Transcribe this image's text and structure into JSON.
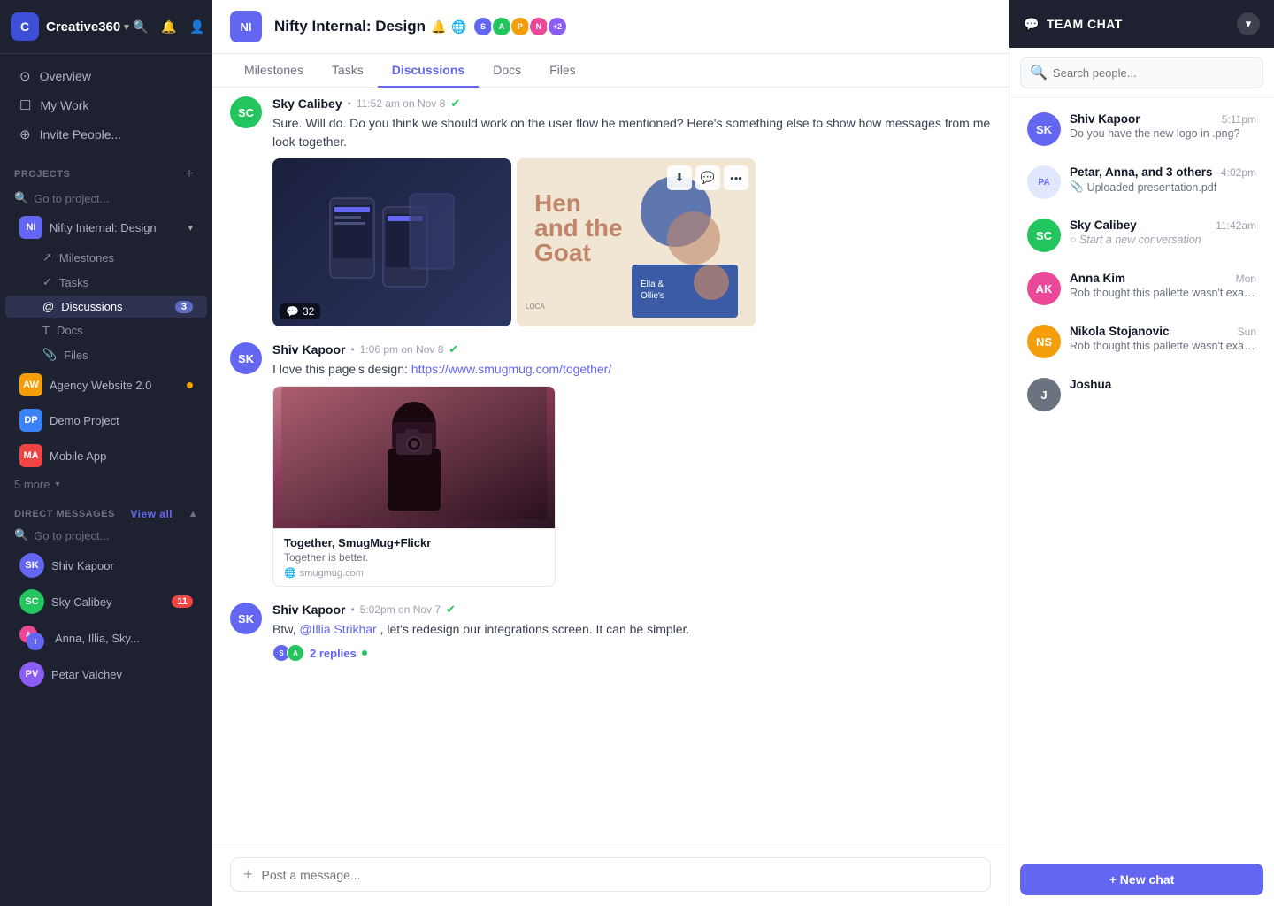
{
  "app": {
    "name": "Creative360",
    "logo_letter": "C"
  },
  "sidebar": {
    "nav": [
      {
        "label": "Overview",
        "icon": "⊙",
        "id": "overview"
      },
      {
        "label": "My Work",
        "icon": "☐",
        "id": "my-work"
      },
      {
        "label": "Invite People...",
        "icon": "⊕",
        "id": "invite"
      }
    ],
    "projects_label": "PROJECTS",
    "projects_add": "+",
    "projects_search_placeholder": "Go to project...",
    "projects": [
      {
        "label": "Nifty Internal: Design",
        "badge": "NI",
        "color": "#6366f1",
        "expanded": true
      },
      {
        "label": "Agency Website 2.0",
        "badge": "AW",
        "color": "#f59e0b",
        "has_dot": true
      },
      {
        "label": "Demo Project",
        "badge": "DP",
        "color": "#3b82f6"
      },
      {
        "label": "Mobile App",
        "badge": "MA",
        "color": "#ef4444"
      }
    ],
    "more_label": "5 more",
    "sub_nav": [
      {
        "label": "Milestones",
        "icon": "↗"
      },
      {
        "label": "Tasks",
        "icon": "✓"
      },
      {
        "label": "Discussions",
        "icon": "@",
        "active": true,
        "badge": 3
      },
      {
        "label": "Docs",
        "icon": "T"
      },
      {
        "label": "Files",
        "icon": "⌂"
      }
    ],
    "dm_label": "DIRECT MESSAGES",
    "dm_view_all": "View all",
    "dm_search_placeholder": "Go to project...",
    "dm_items": [
      {
        "name": "Shiv Kapoor",
        "avatar_color": "#6366f1",
        "initials": "SK"
      },
      {
        "name": "Sky Calibey",
        "avatar_color": "#22c55e",
        "initials": "SC",
        "badge": 11
      },
      {
        "name": "Anna, Illia, Sky...",
        "avatar_color": "#f59e0b",
        "initials": "AI",
        "is_group": true
      },
      {
        "name": "Petar Valchev",
        "avatar_color": "#8b5cf6",
        "initials": "PV"
      }
    ]
  },
  "header": {
    "project_badge": "NI",
    "project_badge_color": "#6366f1",
    "project_title": "Nifty Internal: Design",
    "title_icons": [
      "🔔",
      "🌐"
    ],
    "avatars_extra": "+2",
    "tabs": [
      "Milestones",
      "Tasks",
      "Discussions",
      "Docs",
      "Files"
    ],
    "active_tab": "Discussions"
  },
  "messages": [
    {
      "id": "msg1",
      "author": "Sky Calibey",
      "time": "11:52 am on Nov 8",
      "verified": true,
      "text": "Sure. Will do. Do you think we should work on the user flow he mentioned? Here's something else to show how messages from me look together.",
      "has_images": true,
      "image_count": "32"
    },
    {
      "id": "msg2",
      "author": "Shiv Kapoor",
      "time": "1:06 pm on Nov 8",
      "verified": true,
      "text": "I love this page's design: ",
      "link_text": "https://www.smugmug.com/together/",
      "has_link_preview": true,
      "link_preview_title": "Together, SmugMug+Flickr",
      "link_preview_desc": "Together is better.",
      "link_preview_domain": "smugmug.com"
    },
    {
      "id": "msg3",
      "author": "Shiv Kapoor",
      "time": "5:02pm on Nov 7",
      "verified": true,
      "text_pre": "Btw, ",
      "mention": "@Illia Strikhar",
      "text_post": ", let's redesign our integrations screen. It can be simpler.",
      "has_replies": true,
      "reply_count": "2 replies",
      "reply_dot": true
    }
  ],
  "message_input": {
    "placeholder": "Post a message..."
  },
  "team_chat": {
    "title": "TEAM CHAT",
    "search_placeholder": "Search people...",
    "conversations": [
      {
        "name": "Shiv Kapoor",
        "time": "5:11pm",
        "preview": "Do you have the new logo in .png?",
        "avatar_color": "#6366f1",
        "initials": "SK"
      },
      {
        "name": "Petar, Anna, and 3 others",
        "time": "4:02pm",
        "preview": "📎 Uploaded presentation.pdf",
        "avatar_color": "#8b5cf6",
        "initials": "PA",
        "is_group": true
      },
      {
        "name": "Sky Calibey",
        "time": "11:42am",
        "preview": "Start a new conversation",
        "avatar_color": "#22c55e",
        "initials": "SC",
        "is_new": true
      },
      {
        "name": "Anna Kim",
        "time": "Mon",
        "preview": "Rob thought this pallette wasn't exactly w...",
        "avatar_color": "#ec4899",
        "initials": "AK"
      },
      {
        "name": "Nikola Stojanovic",
        "time": "Sun",
        "preview": "Rob thought this pallette wasn't exactly w...",
        "avatar_color": "#f59e0b",
        "initials": "NS"
      },
      {
        "name": "Joshua",
        "time": "",
        "preview": "",
        "avatar_color": "#6b7280",
        "initials": "J"
      }
    ],
    "new_chat_label": "+ New chat"
  }
}
